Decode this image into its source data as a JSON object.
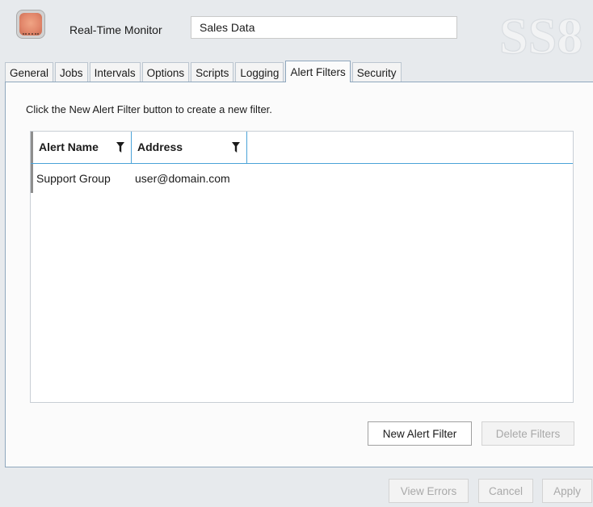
{
  "header": {
    "app_icon": "gauge-icon",
    "product_label": "Real-Time Monitor",
    "name_value": "Sales Data",
    "watermark_text": "SS8"
  },
  "tabs": [
    {
      "label": "General",
      "active": false
    },
    {
      "label": "Jobs",
      "active": false
    },
    {
      "label": "Intervals",
      "active": false
    },
    {
      "label": "Options",
      "active": false
    },
    {
      "label": "Scripts",
      "active": false
    },
    {
      "label": "Logging",
      "active": false
    },
    {
      "label": "Alert Filters",
      "active": true
    },
    {
      "label": "Security",
      "active": false
    }
  ],
  "alert_filters": {
    "instruction": "Click the New Alert Filter button to create a new filter.",
    "columns": [
      "Alert Name",
      "Address"
    ],
    "filter_icon": "funnel-icon",
    "rows": [
      [
        "Support Group",
        "user@domain.com"
      ]
    ],
    "new_button": "New Alert Filter",
    "delete_button": "Delete Filters"
  },
  "footer": {
    "view_errors": "View Errors",
    "cancel": "Cancel",
    "apply": "Apply"
  },
  "colors": {
    "accent_border": "#4aa3d8",
    "panel_border": "#8fa7bd",
    "disabled_text": "#a9a9a9"
  }
}
